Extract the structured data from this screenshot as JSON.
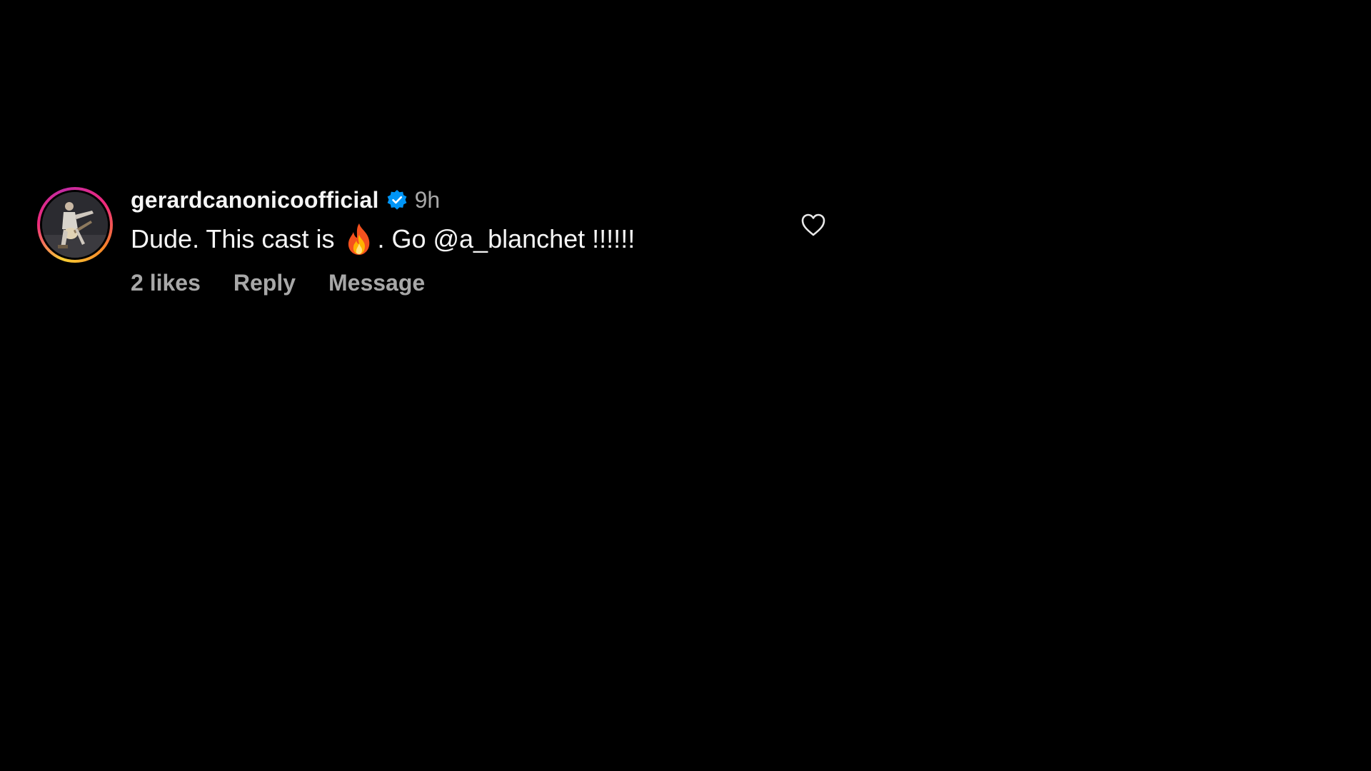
{
  "comment": {
    "username": "gerardcanonicoofficial",
    "verified": true,
    "timestamp": "9h",
    "text_before_emoji": "Dude. This cast is",
    "emoji": "fire-icon",
    "text_after_emoji": ". Go @a_blanchet !!!!!!",
    "likes_label": "2 likes",
    "reply_label": "Reply",
    "message_label": "Message",
    "like_icon": "heart-outline-icon",
    "avatar_icon": "profile-photo"
  },
  "colors": {
    "background": "#000000",
    "primary_text": "#f5f5f5",
    "secondary_text": "#a8a8a8",
    "verified_badge": "#0095f6"
  }
}
